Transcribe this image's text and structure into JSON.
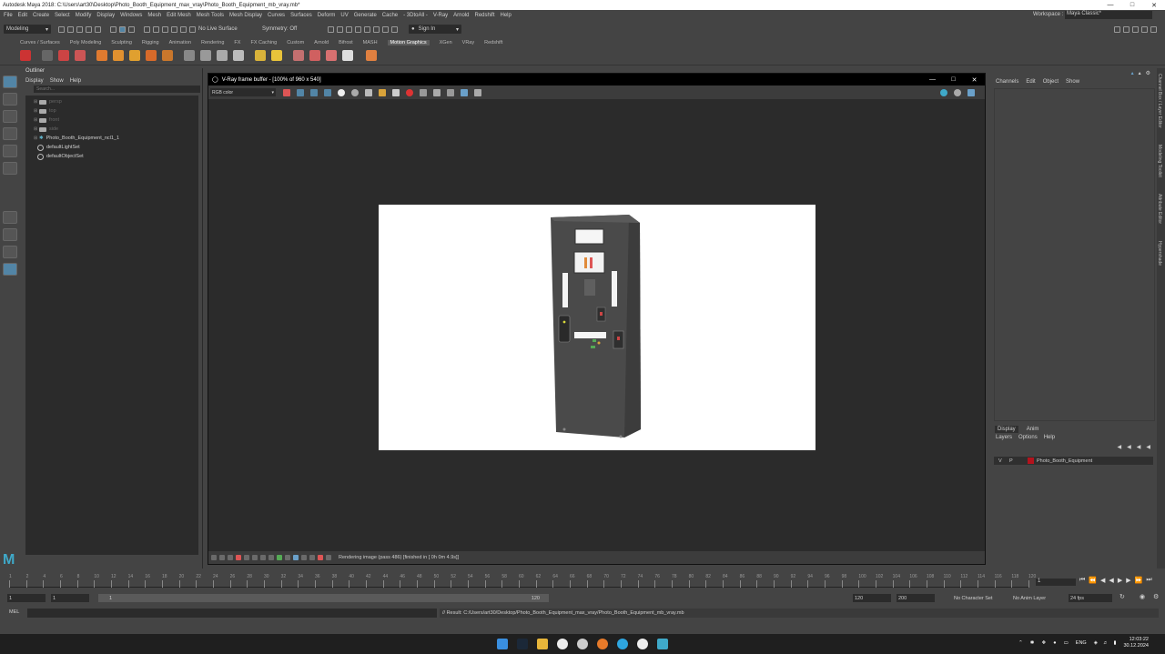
{
  "window": {
    "title": "Autodesk Maya 2018: C:\\Users\\art30\\Desktop\\Photo_Booth_Equipment_max_vray\\Photo_Booth_Equipment_mb_vray.mb*"
  },
  "menubar": {
    "items": [
      "File",
      "Edit",
      "Create",
      "Select",
      "Modify",
      "Display",
      "Windows",
      "Mesh",
      "Edit Mesh",
      "Mesh Tools",
      "Mesh Display",
      "Curves",
      "Surfaces",
      "Deform",
      "UV",
      "Generate",
      "Cache",
      "- 3DtoAll -",
      "V-Ray",
      "Arnold",
      "Redshift",
      "Help"
    ],
    "workspace_label": "Workspace :",
    "workspace_value": "Maya Classic*"
  },
  "statusline": {
    "mode": "Modeling",
    "live_surface": "No Live Surface",
    "symmetry": "Symmetry: Off",
    "sign_in": "Sign In"
  },
  "shelf": {
    "tabs": [
      "Curves / Surfaces",
      "Poly Modeling",
      "Sculpting",
      "Rigging",
      "Animation",
      "Rendering",
      "FX",
      "FX Caching",
      "Custom",
      "Arnold",
      "Bifrost",
      "MASH",
      "Motion Graphics",
      "XGen",
      "VRay",
      "Redshift"
    ],
    "active_tab": "Motion Graphics"
  },
  "outliner": {
    "title": "Outliner",
    "menu": [
      "Display",
      "Show",
      "Help"
    ],
    "search_placeholder": "Search...",
    "items": [
      {
        "label": "persp",
        "type": "camera"
      },
      {
        "label": "top",
        "type": "camera"
      },
      {
        "label": "front",
        "type": "camera"
      },
      {
        "label": "side",
        "type": "camera"
      },
      {
        "label": "Photo_Booth_Equipment_ncl1_1",
        "type": "group"
      },
      {
        "label": "defaultLightSet",
        "type": "set"
      },
      {
        "label": "defaultObjectSet",
        "type": "set"
      }
    ]
  },
  "vfb": {
    "title": "V-Ray frame buffer - [100% of 960 x 540]",
    "channel": "RGB color",
    "status": "Rendering image (pass 486) [finished in [ 0h  0m  4.9s]]"
  },
  "channelbox": {
    "menu": [
      "Channels",
      "Edit",
      "Object",
      "Show"
    ]
  },
  "layers": {
    "tabs": [
      "Display",
      "Anim"
    ],
    "menu": [
      "Layers",
      "Options",
      "Help"
    ],
    "layer_v": "V",
    "layer_p": "P",
    "layer_name": "Photo_Booth_Equipment",
    "layer_color": "#b3131d"
  },
  "sidetabs": [
    "Channel Box / Layer Editor",
    "Modeling Toolkit",
    "Attribute Editor",
    "Hypershade"
  ],
  "timeline": {
    "ticks": [
      "1",
      "2",
      "4",
      "6",
      "8",
      "10",
      "12",
      "14",
      "16",
      "18",
      "20",
      "22",
      "24",
      "26",
      "28",
      "30",
      "32",
      "34",
      "36",
      "38",
      "40",
      "42",
      "44",
      "46",
      "48",
      "50",
      "52",
      "54",
      "56",
      "58",
      "60",
      "62",
      "64",
      "66",
      "68",
      "70",
      "72",
      "74",
      "76",
      "78",
      "80",
      "82",
      "84",
      "86",
      "88",
      "90",
      "92",
      "94",
      "96",
      "98",
      "100",
      "102",
      "104",
      "106",
      "108",
      "110",
      "112",
      "114",
      "116",
      "118",
      "120"
    ],
    "current_frame": "1"
  },
  "range": {
    "start": "1",
    "inner_start": "1",
    "slider_start": "1",
    "slider_end": "120",
    "inner_end": "120",
    "end": "200",
    "character_set": "No Character Set",
    "anim_layer": "No Anim Layer",
    "fps": "24 fps"
  },
  "cmdline": {
    "label": "MEL",
    "result": "// Result: C:/Users/art30/Desktop/Photo_Booth_Equipment_max_vray/Photo_Booth_Equipment_mb_vray.mb"
  },
  "taskbar": {
    "lang": "ENG",
    "time": "12:03:22",
    "date": "30.12.2024"
  },
  "colors": {
    "accent": "#5285a6",
    "maya_logo": "#3fa9c9"
  }
}
